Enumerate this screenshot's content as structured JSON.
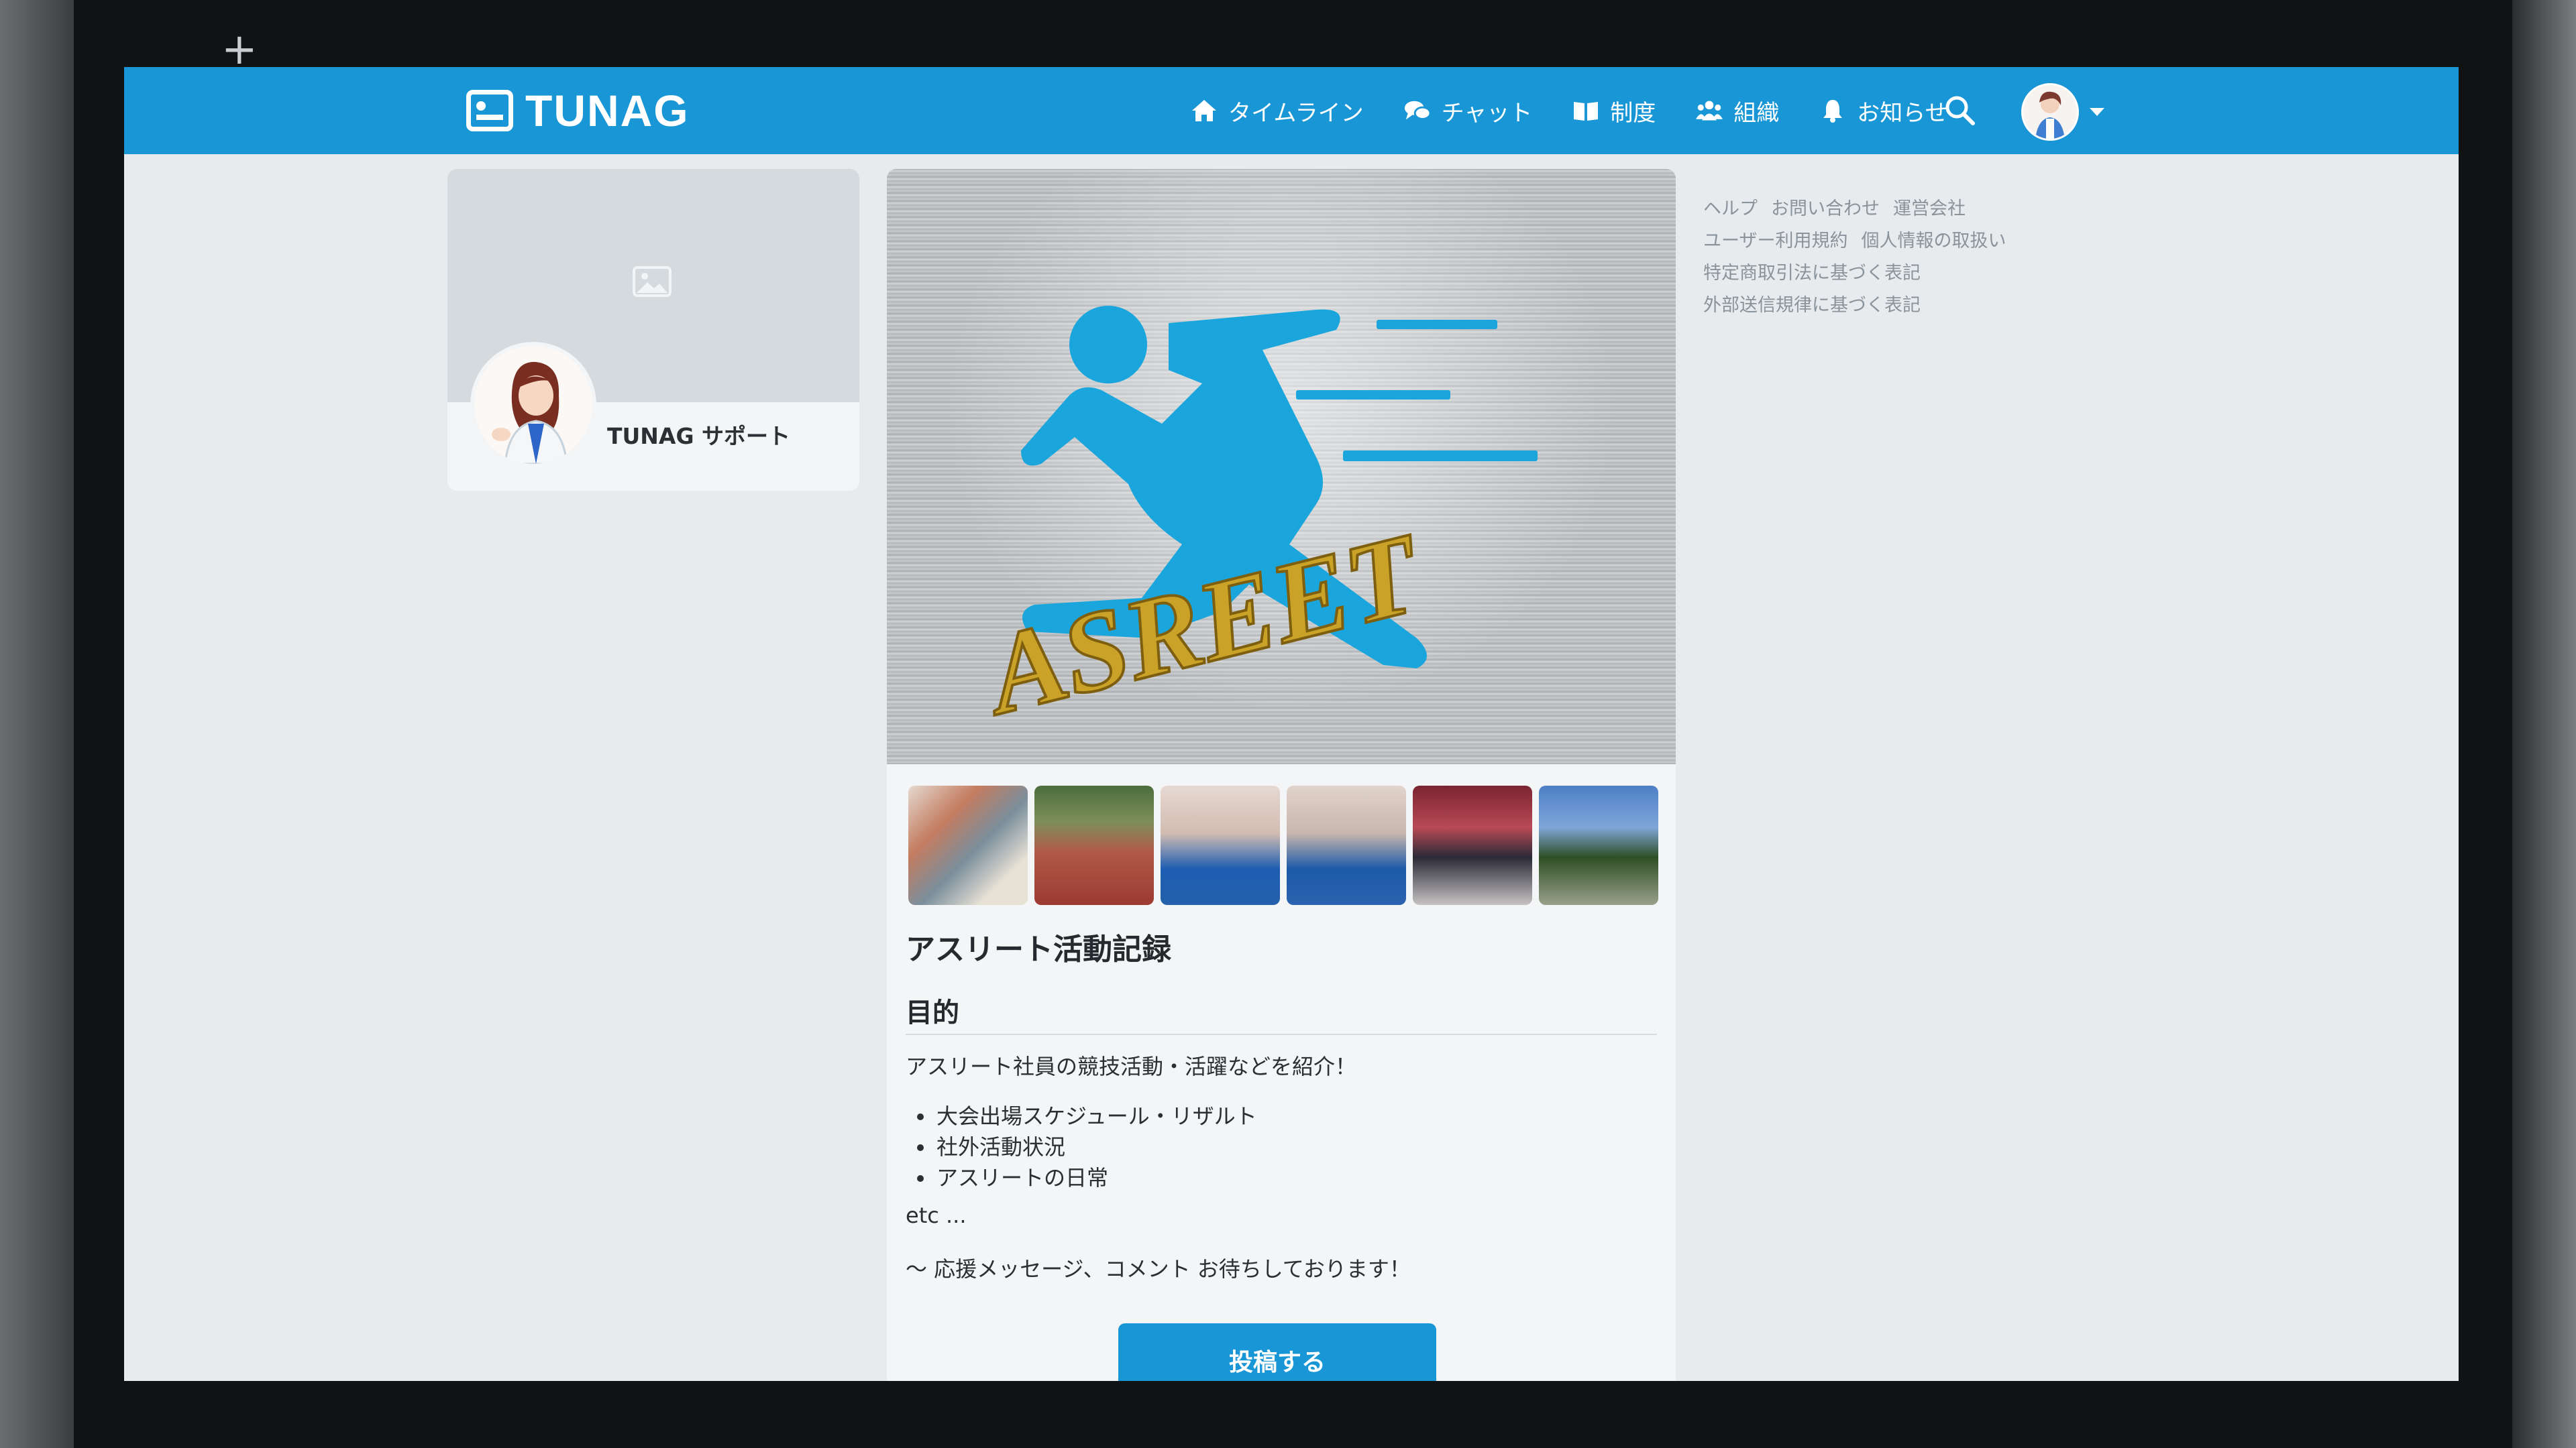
{
  "header": {
    "logo_text": "TUNAG",
    "nav": [
      {
        "label": "タイムライン",
        "icon": "home-icon"
      },
      {
        "label": "チャット",
        "icon": "chat-icon"
      },
      {
        "label": "制度",
        "icon": "book-icon"
      },
      {
        "label": "組織",
        "icon": "people-icon"
      },
      {
        "label": "お知らせ",
        "icon": "bell-icon"
      }
    ],
    "search_icon": "search-icon",
    "avatar_menu_icon": "caret-down-icon"
  },
  "profile": {
    "name": "TUNAG サポート",
    "cover_icon": "image-placeholder-icon"
  },
  "group": {
    "banner_text": "ASREET",
    "title": "アスリート活動記録",
    "section_heading": "目的",
    "purpose": "アスリート社員の競技活動・活躍などを紹介！",
    "bullets": [
      "大会出場スケジュール・リザルト",
      "社外活動状況",
      "アスリートの日常"
    ],
    "etc": "etc ...",
    "message": "〜 応援メッセージ、コメント お待ちしております！",
    "post_button": "投稿する",
    "thumbnail_count": 6
  },
  "side_links": {
    "row1": [
      "ヘルプ",
      "お問い合わせ",
      "運営会社"
    ],
    "row2": [
      "ユーザー利用規約",
      "個人情報の取扱い"
    ],
    "row3": [
      "特定商取引法に基づく表記"
    ],
    "row4": [
      "外部送信規律に基づく表記"
    ]
  },
  "colors": {
    "brand_blue": "#1996d6",
    "banner_runner": "#1aa6dc",
    "banner_text_gold": "#c9a227",
    "page_background": "#e7ebee"
  }
}
